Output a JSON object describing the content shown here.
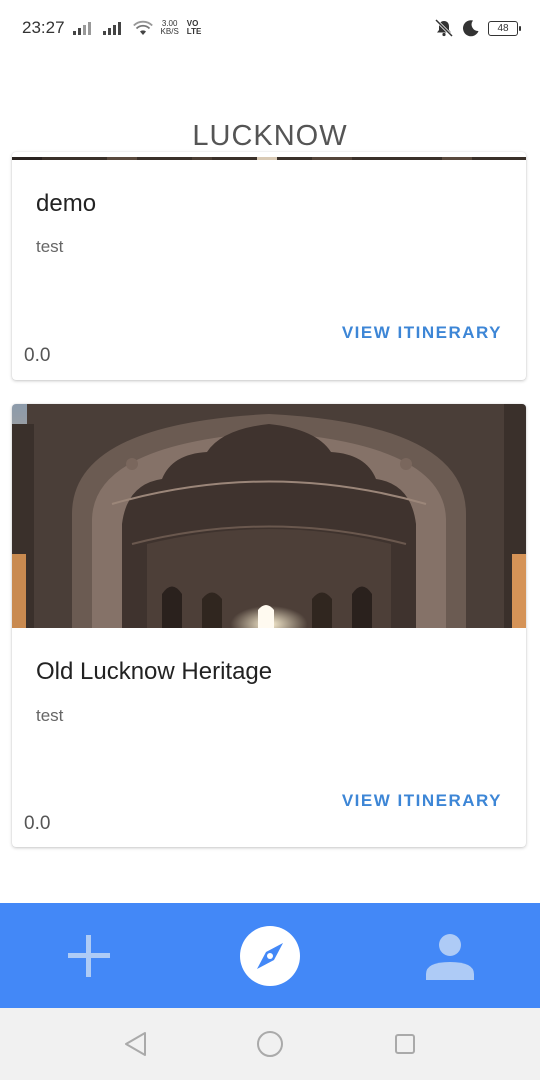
{
  "status_bar": {
    "time": "23:27",
    "net_speed_value": "3.00",
    "net_speed_unit": "KB/S",
    "volte_top": "VO",
    "volte_bottom": "LTE",
    "battery": "48"
  },
  "page": {
    "title": "LUCKNOW"
  },
  "cards": [
    {
      "title": "demo",
      "description": "test",
      "action_label": "VIEW ITINERARY",
      "rating": "0.0"
    },
    {
      "title": "Old Lucknow Heritage",
      "description": "test",
      "action_label": "VIEW ITINERARY",
      "rating": "0.0"
    }
  ],
  "bottom_nav": {
    "background": "#4388f7",
    "items": [
      {
        "icon": "plus-icon"
      },
      {
        "icon": "compass-icon",
        "active": true
      },
      {
        "icon": "person-icon"
      }
    ]
  },
  "colors": {
    "accent": "#3d86d6",
    "nav_bar": "#4388f7"
  }
}
